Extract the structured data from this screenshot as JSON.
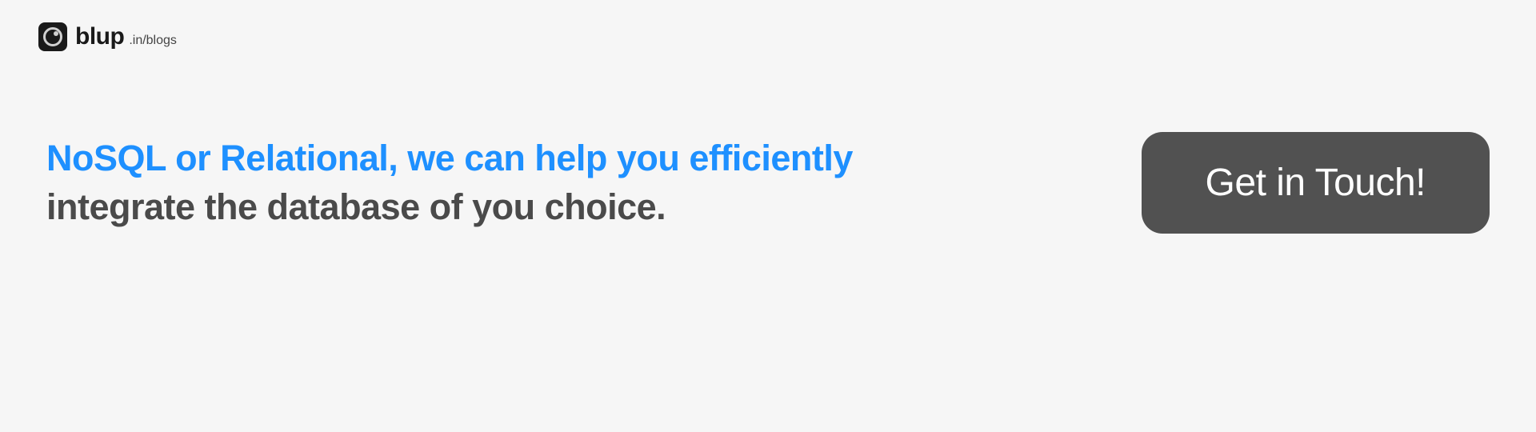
{
  "logo": {
    "name": "blup",
    "suffix": ".in/blogs"
  },
  "headline": {
    "highlight": "NoSQL or Relational, we can help you efficiently",
    "rest": " integrate the database of you choice."
  },
  "cta": {
    "label": "Get in Touch!"
  }
}
